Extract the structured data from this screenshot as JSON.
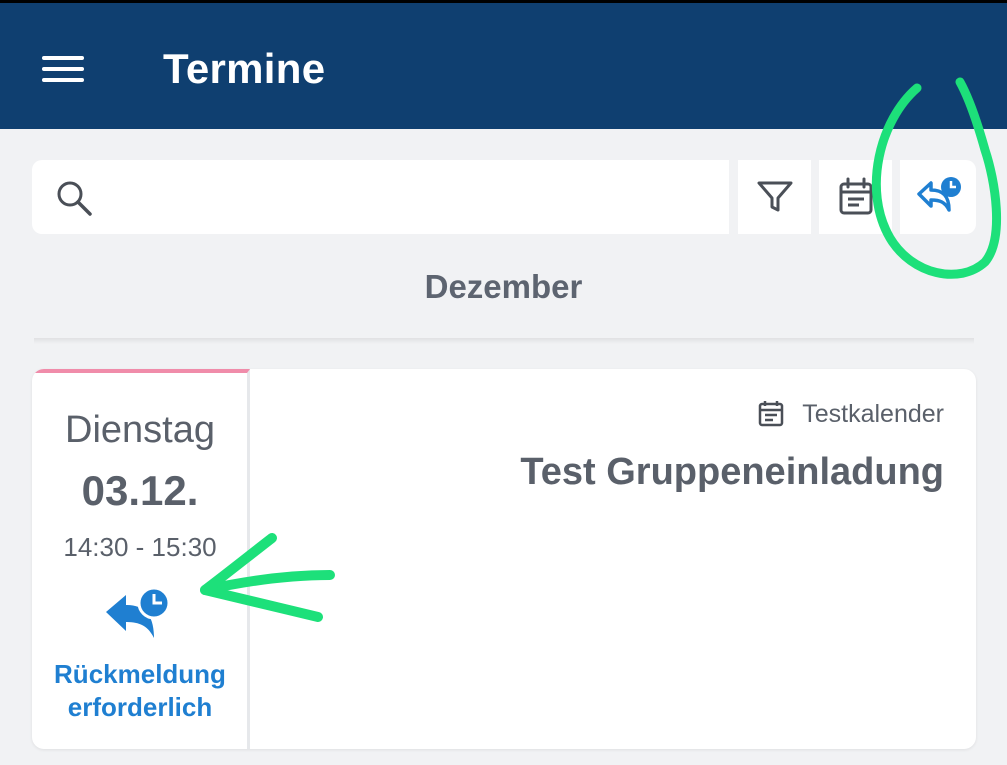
{
  "app": {
    "title": "Termine"
  },
  "search": {
    "placeholder": "",
    "value": ""
  },
  "toolbar": {
    "filter_icon": "filter-icon",
    "calendar_icon": "calendar-icon",
    "reply_icon": "reply-pending-icon"
  },
  "month": "Dezember",
  "events": [
    {
      "weekday": "Dienstag",
      "date": "03.12.",
      "time": "14:30 - 15:30",
      "status": "Rückmeldung erforderlich",
      "calendar": "Testkalender",
      "title": "Test Gruppeneinladung",
      "accent_color": "#f08caa"
    }
  ],
  "colors": {
    "header": "#0f3f70",
    "accent": "#1f7fd1",
    "annotation": "#1de07a"
  }
}
